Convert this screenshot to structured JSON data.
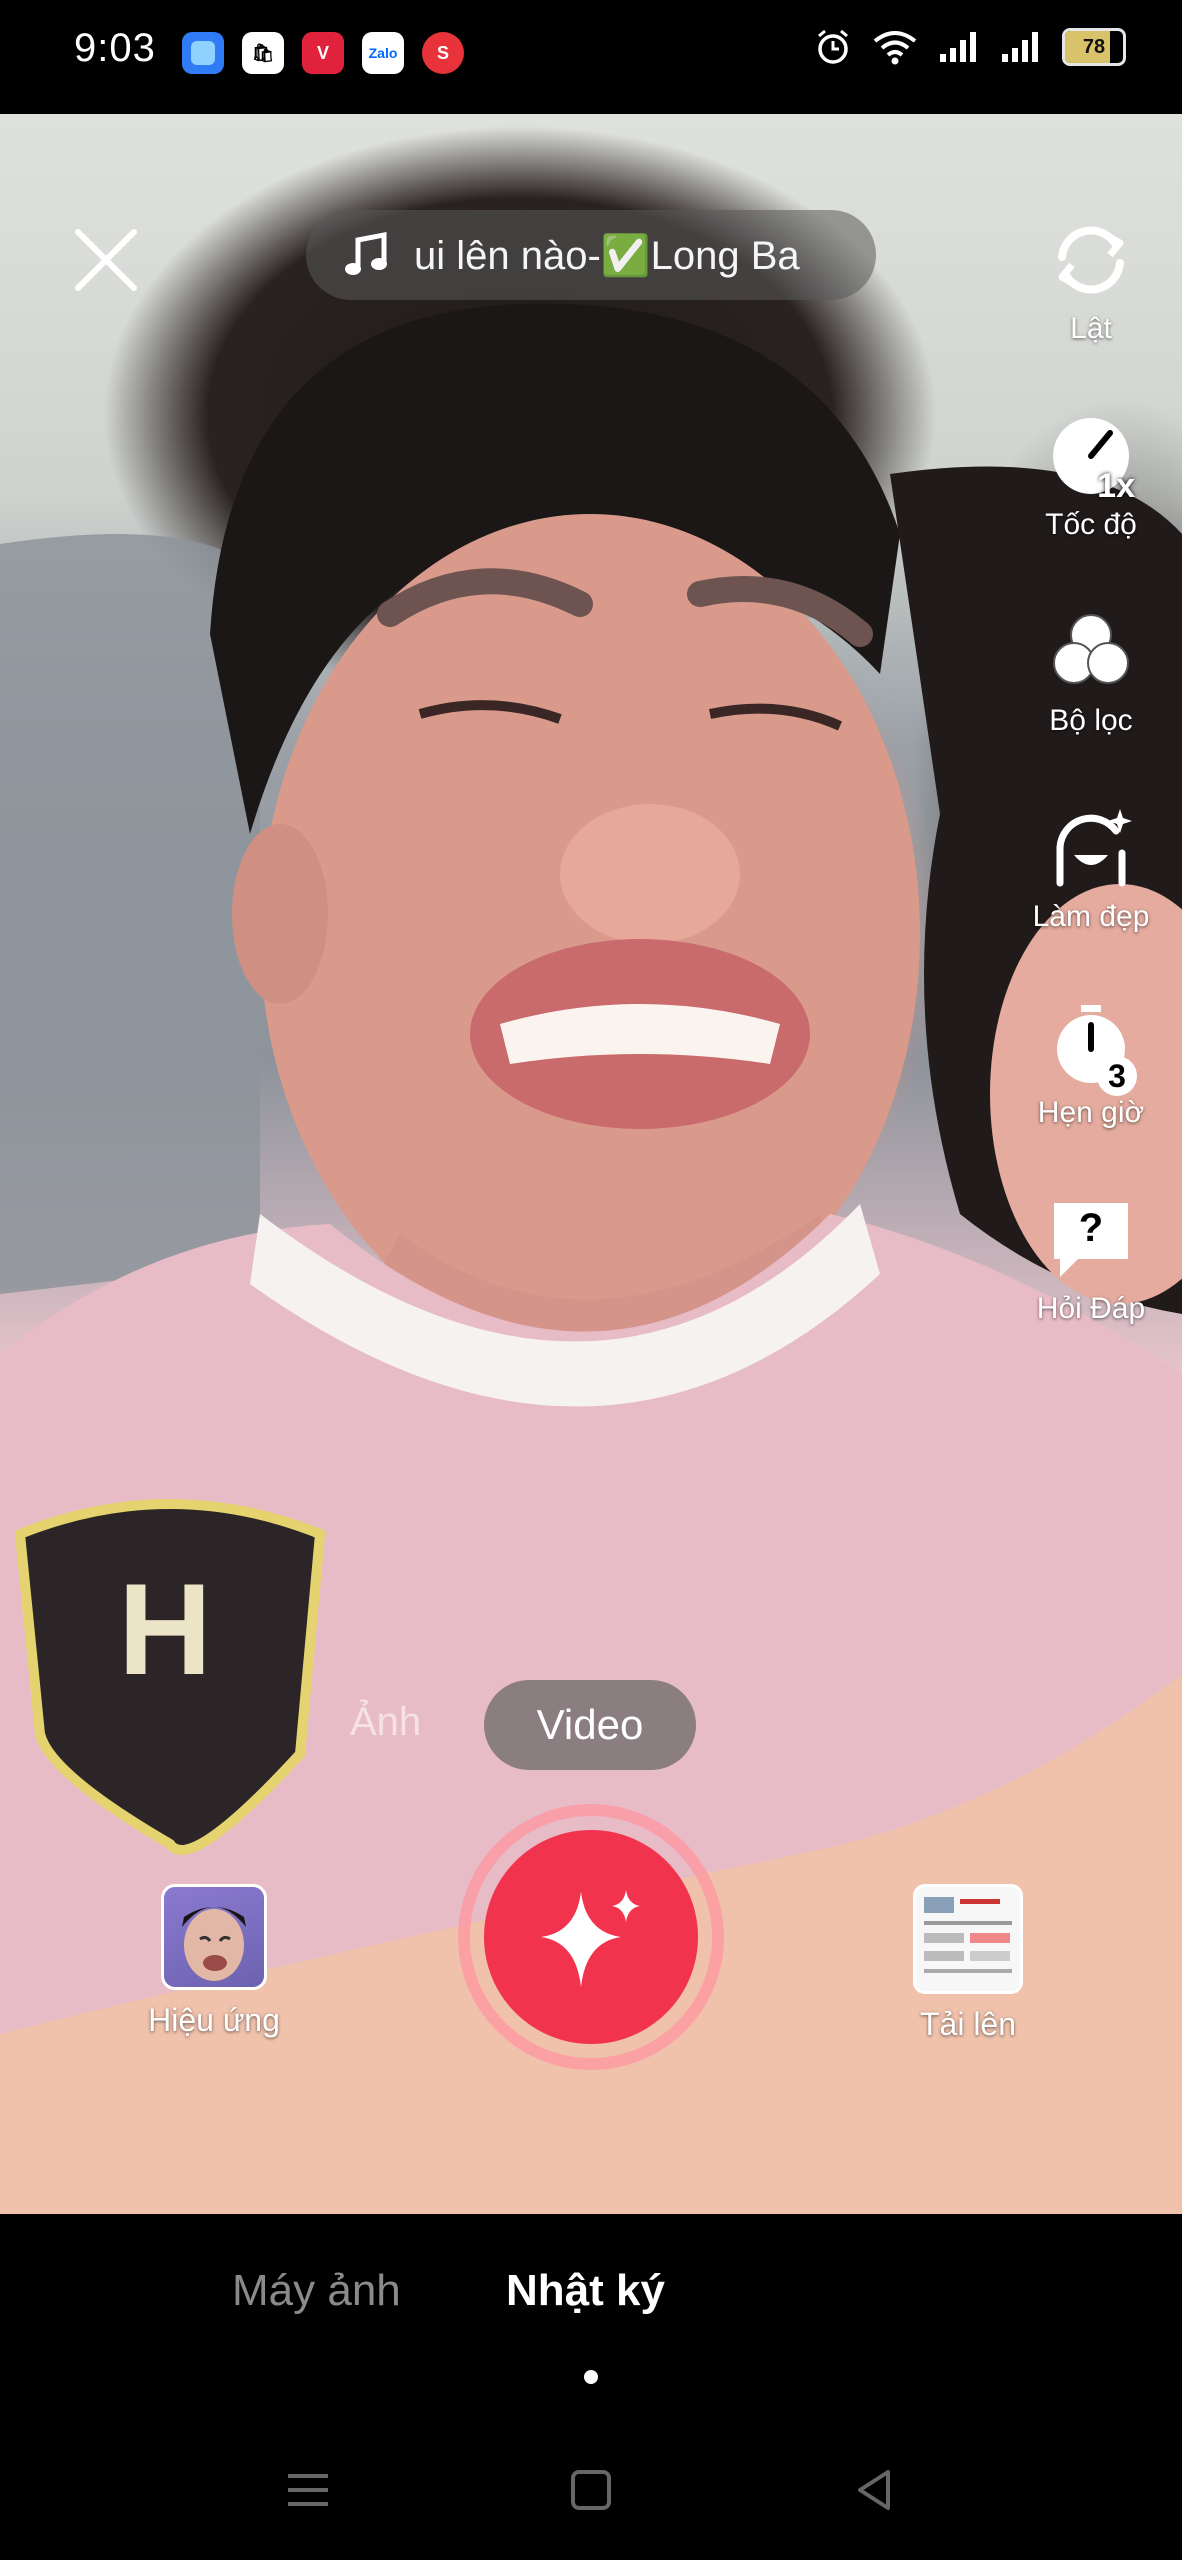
{
  "status_bar": {
    "time": "9:03",
    "battery": "78",
    "battery_level_percent": 78,
    "notification_icons": [
      "blue-app-icon",
      "shopee-icon",
      "vimeo-like-icon",
      "zalo-icon",
      "s-app-icon"
    ],
    "zalo_label": "Zalo",
    "system_icons": [
      "alarm-icon",
      "wifi-icon",
      "signal-icon",
      "signal-icon"
    ]
  },
  "top": {
    "close_icon": "close-icon",
    "music_text": "ui lên nào-✅Long Ba"
  },
  "tools": [
    {
      "icon": "flip-icon",
      "label": "Lật"
    },
    {
      "icon": "speed-icon",
      "label": "Tốc độ",
      "badge": "1x"
    },
    {
      "icon": "filter-icon",
      "label": "Bộ lọc"
    },
    {
      "icon": "beauty-icon",
      "label": "Làm đẹp"
    },
    {
      "icon": "timer-icon",
      "label": "Hẹn giờ",
      "badge": "3"
    },
    {
      "icon": "qa-icon",
      "label": "Hỏi Đáp",
      "badge": "?"
    }
  ],
  "modes": {
    "photo": "Ảnh",
    "video": "Video"
  },
  "bottom": {
    "effects_label": "Hiệu ứng",
    "upload_label": "Tải lên"
  },
  "tabs": {
    "camera": "Máy ảnh",
    "journal": "Nhật ký"
  },
  "colors": {
    "record": "#f2334e",
    "record_ring": "#ff96a0"
  }
}
